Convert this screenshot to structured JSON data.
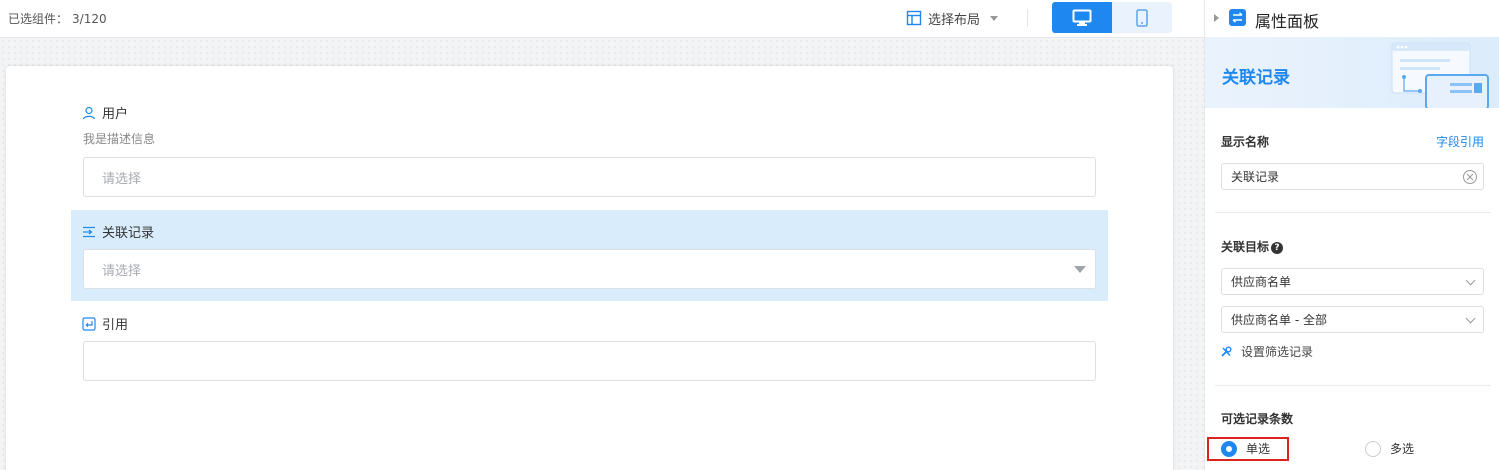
{
  "toolbar": {
    "selected_label": "已选组件：",
    "selected_count": "3/120",
    "layout_label": "选择布局"
  },
  "form": {
    "fields": [
      {
        "label": "用户",
        "description": "我是描述信息",
        "placeholder": "请选择",
        "icon": "user-icon"
      },
      {
        "label": "关联记录",
        "placeholder": "请选择",
        "icon": "link-record-icon"
      },
      {
        "label": "引用",
        "placeholder": "",
        "icon": "reference-icon"
      }
    ]
  },
  "panel": {
    "title": "属性面板",
    "banner_title": "关联记录",
    "display_name_label": "显示名称",
    "field_reference_link": "字段引用",
    "display_name_value": "关联记录",
    "target_label": "关联目标",
    "target_select": "供应商名单",
    "view_select": "供应商名单 - 全部",
    "filter_link": "设置筛选记录",
    "count_label": "可选记录条数",
    "radio_single": "单选",
    "radio_multi": "多选",
    "radio_selected": "single"
  },
  "colors": {
    "accent": "#1e88f0",
    "selected_bg": "#d9ecfb",
    "highlight_border": "#d9251d"
  }
}
